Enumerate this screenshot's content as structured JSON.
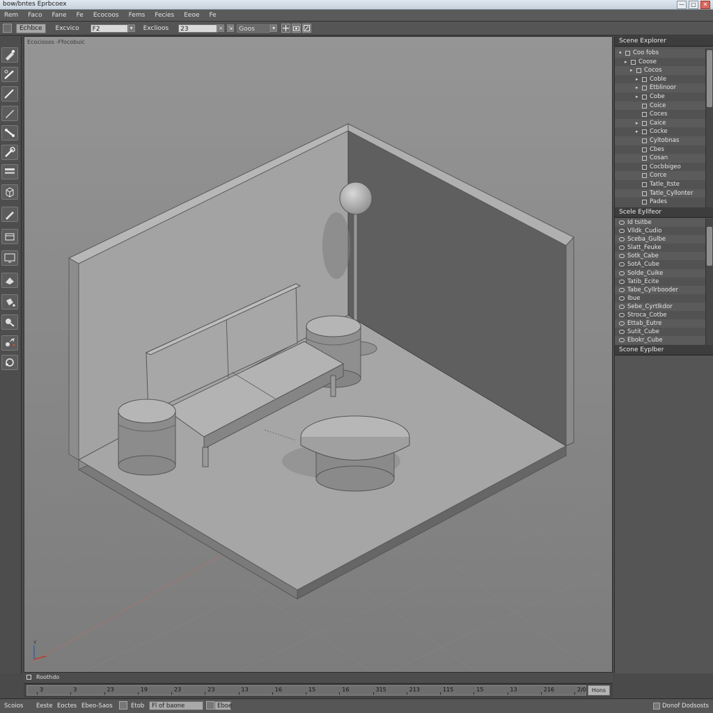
{
  "window": {
    "title": "bow/bntes Eprbcoex",
    "controls": {
      "minimize": "—",
      "maximize": "□",
      "close": "✕"
    }
  },
  "menu": [
    "Rem",
    "Faco",
    "Fane",
    "Fe",
    "Ecocoos",
    "Fems",
    "Fecies",
    "Eeoe",
    "Fe"
  ],
  "toolbar": {
    "left_button": "Echbce",
    "label1": "Excvico",
    "field1": "F2",
    "label2": "Exclioos",
    "field2": "23",
    "field3": "Goos",
    "icons": [
      "move-icon",
      "camera-icon",
      "render-icon"
    ]
  },
  "tools": [
    "brush-icon",
    "pen-icon",
    "knife-icon",
    "pencil-icon",
    "bone-icon",
    "wrench-icon",
    "layers-icon",
    "cube-icon",
    "edit-icon",
    "package-icon",
    "monitor-icon",
    "paint-icon",
    "bucket-icon",
    "select-icon",
    "move-icon",
    "rotate-icon"
  ],
  "viewport": {
    "label": "Ecociosos -Ffocobuic"
  },
  "scene_explorer": {
    "title": "Scene Explorer",
    "items": [
      {
        "label": "Coo fobs",
        "indent": 0,
        "arrow": "▾"
      },
      {
        "label": "Coose",
        "indent": 1,
        "arrow": "▸"
      },
      {
        "label": "Cocos",
        "indent": 2,
        "arrow": "▸"
      },
      {
        "label": "Coble",
        "indent": 3,
        "arrow": "▸"
      },
      {
        "label": "Etblinoor",
        "indent": 3,
        "arrow": "▸"
      },
      {
        "label": "Cobe",
        "indent": 3,
        "arrow": "▸"
      },
      {
        "label": "Coice",
        "indent": 3,
        "arrow": ""
      },
      {
        "label": "Coces",
        "indent": 3,
        "arrow": ""
      },
      {
        "label": "Caice",
        "indent": 3,
        "arrow": "▸"
      },
      {
        "label": "Cocke",
        "indent": 3,
        "arrow": "▸"
      },
      {
        "label": "Cyltobnas",
        "indent": 3,
        "arrow": ""
      },
      {
        "label": "Cbes",
        "indent": 3,
        "arrow": ""
      },
      {
        "label": "Cosan",
        "indent": 3,
        "arrow": ""
      },
      {
        "label": "Cocbbigeo",
        "indent": 3,
        "arrow": ""
      },
      {
        "label": "Corce",
        "indent": 3,
        "arrow": ""
      },
      {
        "label": "Tatle_Itste",
        "indent": 3,
        "arrow": ""
      },
      {
        "label": "Tatle_Cyllonter",
        "indent": 3,
        "arrow": ""
      },
      {
        "label": "Pades",
        "indent": 3,
        "arrow": ""
      }
    ]
  },
  "second_panel": {
    "title": "Scele Eyllfeor",
    "items": [
      "Id tsitbe",
      "Vlldk_Cudio",
      "Sceba_Gulbe",
      "Slatt_Feuke",
      "Sotk_Cabe",
      "SotA_Cube",
      "Solde_Cuike",
      "Tatib_Ecite",
      "Tabe_Cyllrbooder",
      "Ibue",
      "Sebe_Cyrtlkdor",
      "Stroca_Cotbe",
      "Ettab_Eutre",
      "Sutit_Cube",
      "Ebokr_Cube"
    ]
  },
  "third_panel": {
    "title": "Scone Eyplber"
  },
  "timeline": {
    "label": "Roothdo",
    "ticks": [
      "3",
      "3",
      "23",
      "19",
      "23",
      "23",
      "13",
      "16",
      "15",
      "16",
      "315",
      "213",
      "115",
      "15",
      "13",
      "216",
      "2/0"
    ],
    "end_button": "Hons"
  },
  "status": {
    "items": [
      "Scoios",
      "Eeste",
      "Eoctes",
      "Ebeo-Saos"
    ],
    "field_label": "Etob",
    "dropdown": "Fl of baone",
    "after_field": "Eboe",
    "right": "Donof Dodsosts"
  },
  "colors": {
    "ui_background": "#4a4a4a",
    "viewport_background": "#8a8a8a",
    "panel_header": "#3d3d3d"
  }
}
